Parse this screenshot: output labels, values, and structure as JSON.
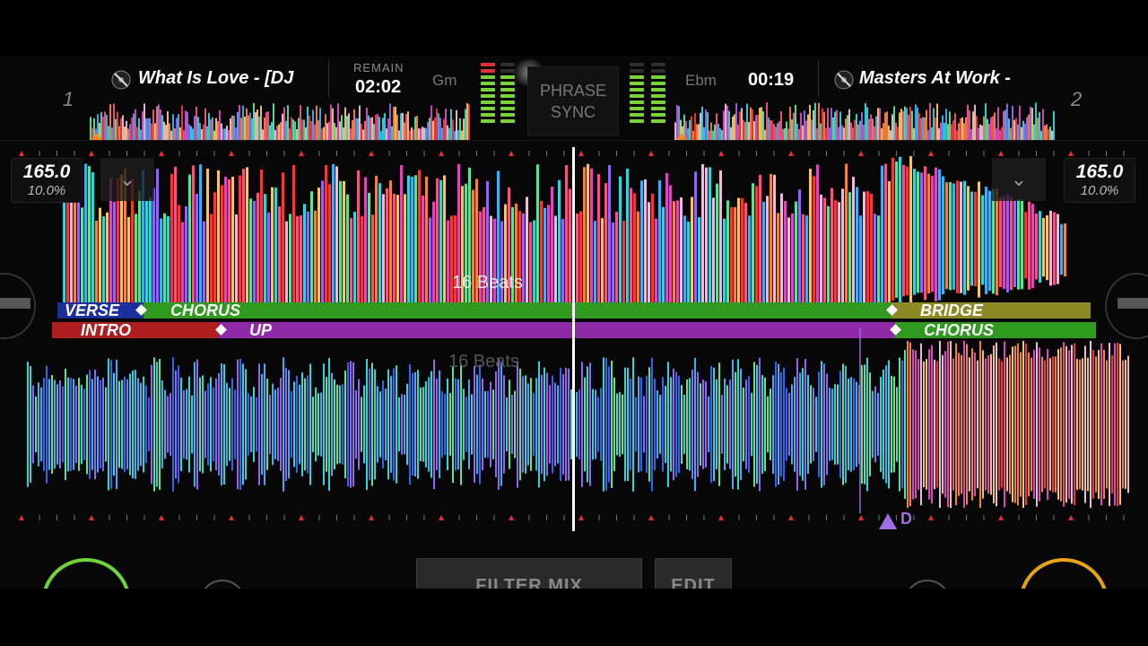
{
  "deck1": {
    "number": "1",
    "title": "What Is Love - [DJ",
    "remain_label": "REMAIN",
    "time": "02:02",
    "key": "Gm",
    "bpm": "165.0",
    "pitch": "10.0%"
  },
  "deck2": {
    "number": "2",
    "title": "Masters At Work -",
    "time": "00:19",
    "key": "Ebm",
    "bpm": "165.0",
    "pitch": "10.0%"
  },
  "center": {
    "phrase_sync_line1": "PHRASE",
    "phrase_sync_line2": "SYNC"
  },
  "waveform": {
    "beats_top": "16 Beats",
    "beats_bottom": "16 Beats"
  },
  "phrases_deck1": [
    {
      "label": "VERSE",
      "color": "#1d2f9b"
    },
    {
      "label": "CHORUS",
      "color": "#2f9a1f"
    },
    {
      "label": "BRIDGE",
      "color": "#8c8a24"
    }
  ],
  "phrases_deck2": [
    {
      "label": "INTRO",
      "color": "#b01f1f"
    },
    {
      "label": "UP",
      "color": "#8e2aa8"
    },
    {
      "label": "CHORUS",
      "color": "#2f9a1f"
    }
  ],
  "cue_marker": "D",
  "bottom": {
    "filter_mix": "FILTER MIX",
    "edit": "EDIT"
  },
  "icons": {
    "vinyl": "vinyl-icon",
    "chevron": "chevron-down-icon",
    "cue": "cue-triangle-icon"
  },
  "colors": {
    "meter_green": "#7ad33a",
    "meter_red": "#e2303b",
    "jog_left": "#6fd33a",
    "jog_right": "#e8a21c"
  }
}
